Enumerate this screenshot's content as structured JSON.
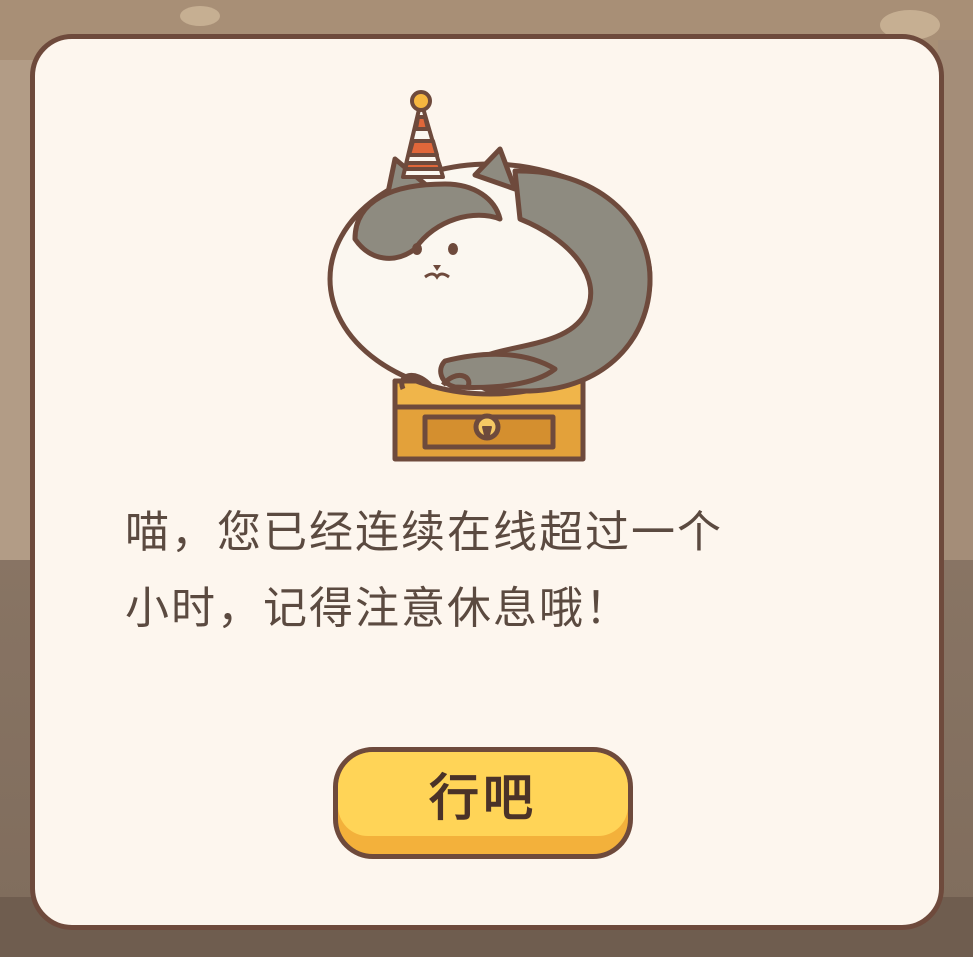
{
  "dialog": {
    "message_line1": "喵，您已经连续在线超过一个",
    "message_line2": "小时，记得注意休息哦！",
    "confirm_button_label": "行吧",
    "illustration": "cat-in-party-hat-on-treasure-chest-icon"
  },
  "colors": {
    "panel_background": "#fdf6ee",
    "panel_border": "#6e4a3c",
    "button_face": "#ffd457",
    "button_shadow": "#f3b13b",
    "text": "#5b4a40"
  }
}
